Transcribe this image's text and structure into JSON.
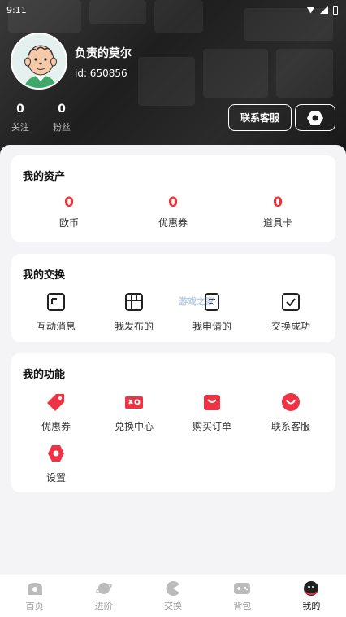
{
  "status_bar": {
    "time": "9:11"
  },
  "profile": {
    "name": "负责的莫尔",
    "id_text": "id: 650856",
    "stats": [
      {
        "value": "0",
        "label": "关注"
      },
      {
        "value": "0",
        "label": "粉丝"
      }
    ],
    "contact_button": "联系客服"
  },
  "assets": {
    "title": "我的资产",
    "items": [
      {
        "value": "0",
        "label": "欧币"
      },
      {
        "value": "0",
        "label": "优惠券"
      },
      {
        "value": "0",
        "label": "道具卡"
      }
    ]
  },
  "exchange": {
    "title": "我的交换",
    "items": [
      {
        "label": "互动消息",
        "icon": "message-icon"
      },
      {
        "label": "我发布的",
        "icon": "grid-icon"
      },
      {
        "label": "我申请的",
        "icon": "request-icon"
      },
      {
        "label": "交换成功",
        "icon": "check-box-icon"
      }
    ]
  },
  "functions": {
    "title": "我的功能",
    "items": [
      {
        "label": "优惠券",
        "icon": "coupon-tag-icon"
      },
      {
        "label": "兑换中心",
        "icon": "redeem-icon"
      },
      {
        "label": "购买订单",
        "icon": "shopping-bag-icon"
      },
      {
        "label": "联系客服",
        "icon": "support-icon"
      },
      {
        "label": "设置",
        "icon": "settings-hex-icon"
      }
    ]
  },
  "watermark": "游戏之家",
  "nav": {
    "items": [
      {
        "label": "首页",
        "icon": "home-icon"
      },
      {
        "label": "进阶",
        "icon": "planet-icon"
      },
      {
        "label": "交换",
        "icon": "pacman-icon"
      },
      {
        "label": "背包",
        "icon": "gamepad-icon"
      },
      {
        "label": "我的",
        "icon": "profile-face-icon",
        "active": true
      }
    ]
  },
  "colors": {
    "accent": "#e8323c",
    "header_bg": "#1e1e1e",
    "text_dark": "#111111"
  }
}
